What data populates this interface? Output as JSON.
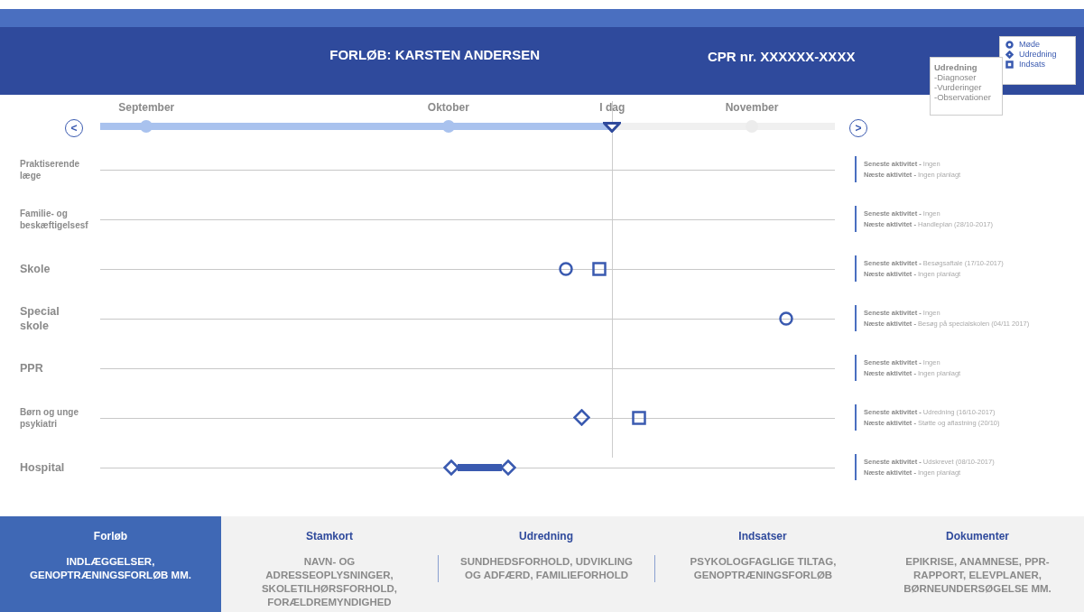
{
  "header": {
    "title": "FORLØB: KARSTEN ANDERSEN",
    "cpr": "CPR nr. XXXXXX-XXXX"
  },
  "legend": [
    {
      "kind": "circle",
      "label": "Møde"
    },
    {
      "kind": "diamond",
      "label": "Udredning"
    },
    {
      "kind": "square",
      "label": "Indsats"
    }
  ],
  "tooltip": {
    "title": "Udredning",
    "lines": [
      "-Diagnoser",
      "-Vurderinger",
      "-Observationer"
    ]
  },
  "timeline": {
    "prev": "<",
    "next": ">",
    "level": 0.697,
    "today": "I dag",
    "months": [
      "September",
      "Oktober",
      "November"
    ]
  },
  "rows": [
    {
      "kind": "small",
      "label": "Praktiserende læge",
      "markers": [],
      "info": [
        "**Seneste aktivitet -** Ingen",
        "**Næste aktivitet -** Ingen planlagt"
      ]
    },
    {
      "kind": "small",
      "label": "Familie- og beskæftigelsesf",
      "markers": [],
      "info": [
        "**Seneste aktivitet -** Ingen",
        "**Næste aktivitet -** Handleplan (28/10-2017)"
      ]
    },
    {
      "kind": "large",
      "label": "Skole",
      "markers": [
        {
          "kind": "circle"
        },
        {
          "kind": "square"
        }
      ],
      "info": [
        "**Seneste aktivitet -** Besøgsaftale (17/10-2017)",
        "**Næste aktivitet -** Ingen planlagt"
      ]
    },
    {
      "kind": "large",
      "label": "Special skole",
      "markers": [
        {
          "kind": "circle"
        }
      ],
      "info": [
        "**Seneste aktivitet -** Ingen",
        "**Næste aktivitet -** Besøg på specialskolen (04/11 2017)"
      ]
    },
    {
      "kind": "large",
      "label": "PPR",
      "markers": [],
      "info": [
        "**Seneste aktivitet -** Ingen",
        "**Næste aktivitet -** Ingen planlagt"
      ]
    },
    {
      "kind": "small",
      "label": "Børn og unge psykiatri",
      "markers": [
        {
          "kind": "diamond"
        },
        {
          "kind": "square"
        }
      ],
      "info": [
        "**Seneste aktivitet -** Udredning  (16/10-2017)",
        "**Næste aktivitet -** Støtte og aflastning (20/10)"
      ]
    },
    {
      "kind": "large",
      "label": "Hospital",
      "markers": [
        {
          "kind": "diamond-range"
        }
      ],
      "info": [
        "**Seneste aktivitet -** Udskrevet (08/10-2017)",
        "**Næste aktivitet -** Ingen planlagt"
      ]
    }
  ],
  "tabs": [
    {
      "title": "Forløb",
      "body": "INDLÆGGELSER, GENOPTRÆNINGSFORLØB MM.",
      "selected": true
    },
    {
      "title": "Stamkort",
      "body": "NAVN- OG ADRESSEOPLYSNINGER, SKOLETILHØRSFORHOLD, FORÆLDREMYNDIGHED",
      "selected": false
    },
    {
      "title": "Udredning",
      "body": "SUNDHEDSFORHOLD, UDVIKLING OG ADFÆRD, FAMILIEFORHOLD",
      "selected": false
    },
    {
      "title": "Indsatser",
      "body": "PSYKOLOGFAGLIGE TILTAG, GENOPTRÆNINGSFORLØB",
      "selected": false
    },
    {
      "title": "Dokumenter",
      "body": "EPIKRISE, ANAMNESE, PPR-RAPPORT, ELEVPLANER, BØRNEUNDERSØGELSE MM.",
      "selected": false
    }
  ]
}
